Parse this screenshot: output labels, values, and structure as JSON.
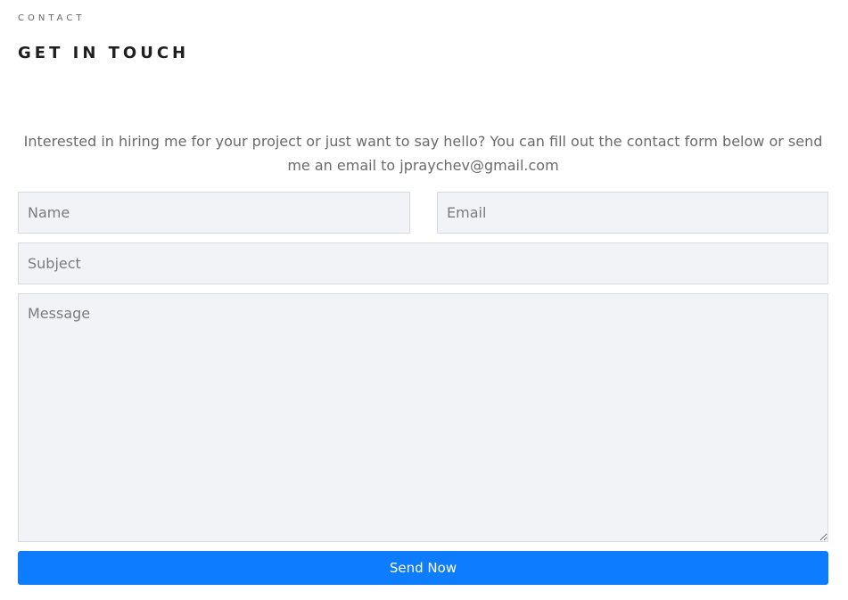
{
  "header": {
    "eyebrow": "CONTACT",
    "title": "GET IN TOUCH"
  },
  "intro": "Interested in hiring me for your project or just want to say hello? You can fill out the contact form below or send me an email to jpraychev@gmail.com",
  "form": {
    "name_placeholder": "Name",
    "email_placeholder": "Email",
    "subject_placeholder": "Subject",
    "message_placeholder": "Message",
    "submit_label": "Send Now"
  },
  "colors": {
    "accent": "#0d7cff",
    "field_bg": "#f2f3f7"
  }
}
